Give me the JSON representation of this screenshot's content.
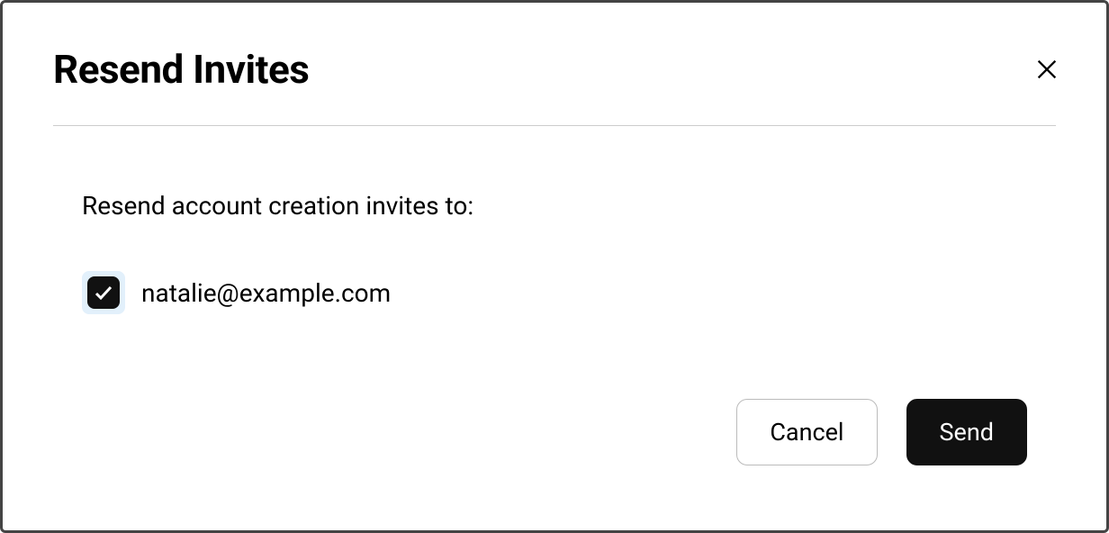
{
  "modal": {
    "title": "Resend Invites",
    "prompt": "Resend account creation invites to:",
    "recipients": [
      {
        "email": "natalie@example.com",
        "checked": true
      }
    ],
    "buttons": {
      "cancel": "Cancel",
      "send": "Send"
    }
  }
}
